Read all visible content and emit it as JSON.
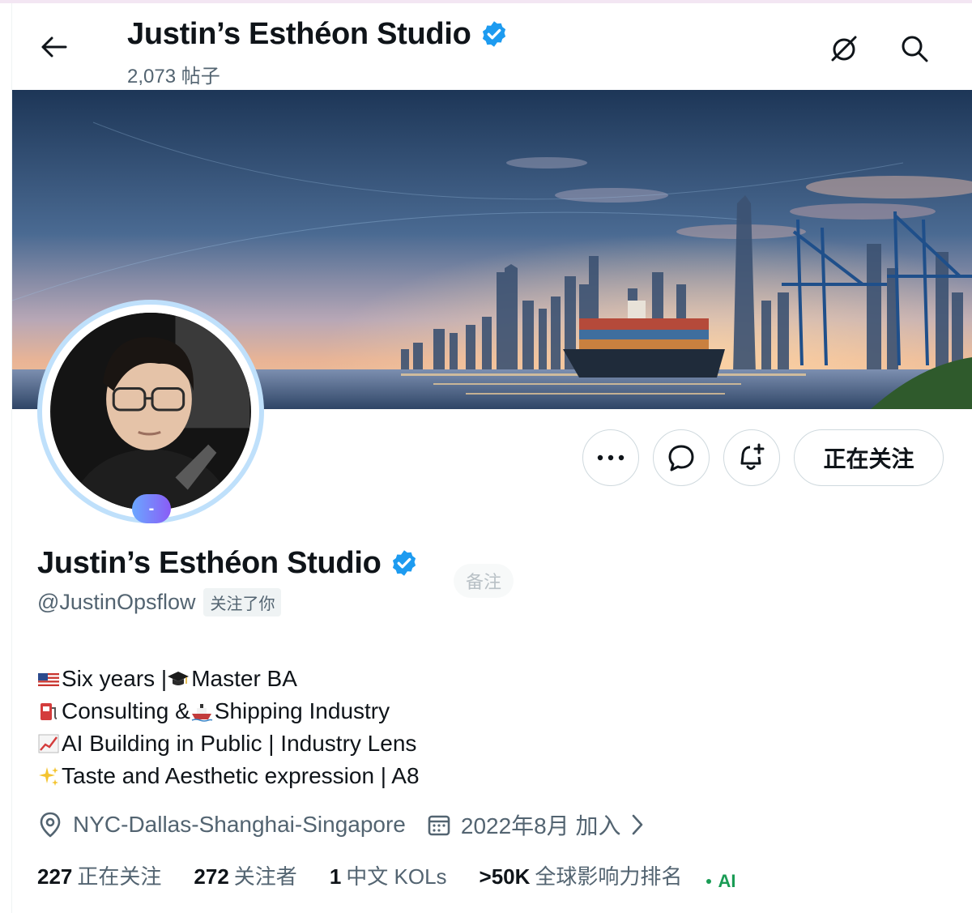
{
  "header": {
    "title": "Justin’s Esthéon Studio",
    "post_count": "2,073 帖子"
  },
  "profile": {
    "name": "Justin’s Esthéon Studio",
    "handle": "@JustinOpsflow",
    "follows_you": "关注了你",
    "note_label": "备注",
    "avatar_badge": "-",
    "verified": true
  },
  "actions": {
    "more_label": "•••",
    "following_label": "正在关注"
  },
  "bio": [
    {
      "icon": "us-flag",
      "text": "Six years | ",
      "icon2": "graduation-cap",
      "text2": "Master BA"
    },
    {
      "icon": "fuel-pump",
      "text": "Consulting & ",
      "icon2": "ship",
      "text2": " Shipping Industry"
    },
    {
      "icon": "chart-increasing",
      "text": "AI Building in Public | Industry Lens"
    },
    {
      "icon": "sparkles",
      "text": " Taste and Aesthetic expression | A8"
    }
  ],
  "meta": {
    "location": "NYC-Dallas-Shanghai-Singapore",
    "joined": "2022年8月 加入"
  },
  "stats": {
    "following_count": "227",
    "following_label": "正在关注",
    "followers_count": "272",
    "followers_label": "关注者",
    "kol_count": "1",
    "kol_label": "中文 KOLs",
    "rank_value": ">50K",
    "rank_label": "全球影响力排名",
    "ai_label": "AI"
  },
  "colors": {
    "verified_blue": "#1d9bf0",
    "ai_green": "#1a9c55",
    "secondary_text": "#536471"
  }
}
